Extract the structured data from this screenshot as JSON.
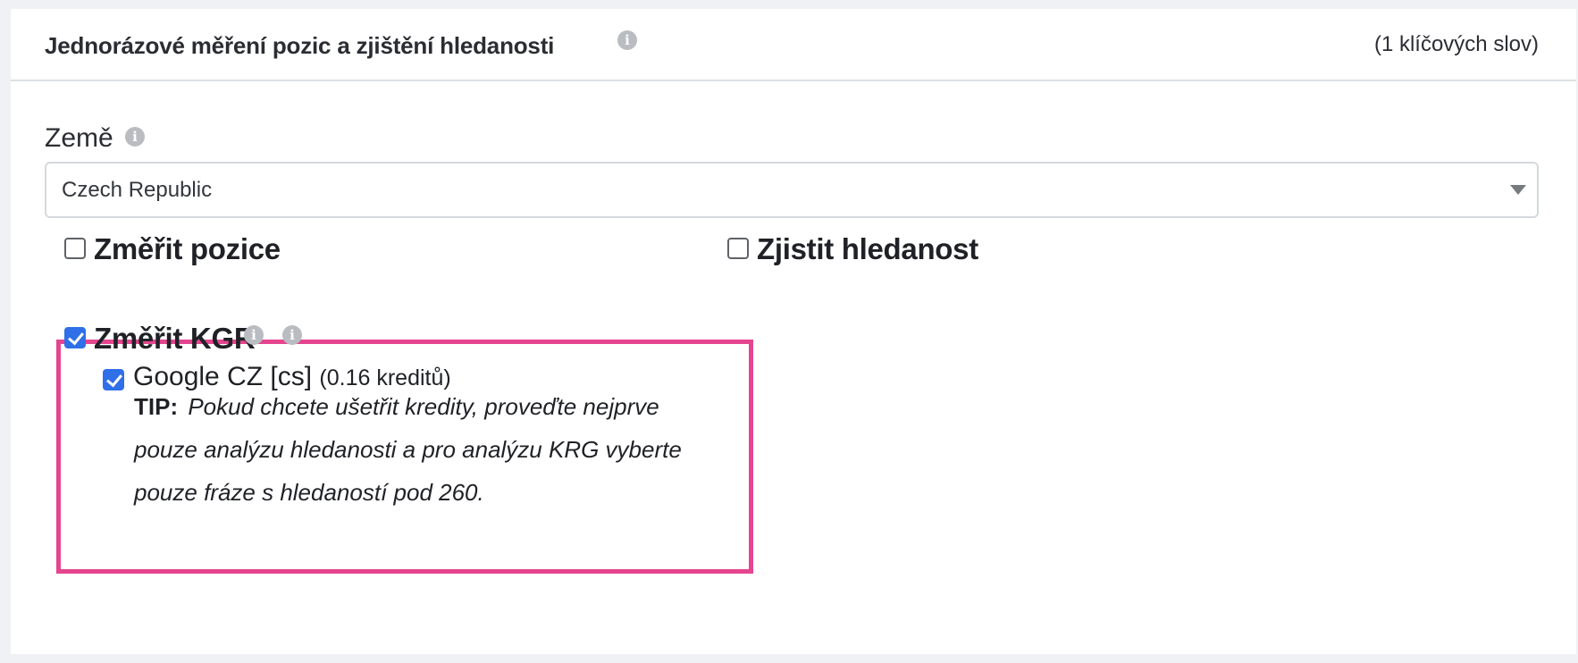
{
  "header": {
    "title": "Jednorázové měření pozic a zjištění hledanosti",
    "keyword_count": "(1 klíčových slov)"
  },
  "country": {
    "label": "Země",
    "selected": "Czech Republic"
  },
  "options": {
    "measure_positions": {
      "label": "Změřit pozice",
      "checked": false
    },
    "find_search_volume": {
      "label": "Zjistit hledanost",
      "checked": false
    },
    "measure_kgr": {
      "label": "Změřit KGR",
      "checked": true
    }
  },
  "kgr": {
    "engine_label": "Google CZ [cs]",
    "engine_credits": "(0.16 kreditů)",
    "engine_checked": true,
    "tip_label": "TIP:",
    "tip_text": "Pokud chcete ušetřit kredity, proveďte nejprve pouze analýzu hledanosti a pro analýzu KRG vyberte pouze fráze s hledaností pod 260."
  },
  "icons": {
    "info": "info-icon",
    "caret": "chevron-down-icon",
    "check": "checkmark-icon"
  },
  "colors": {
    "accent": "#2f6fe8",
    "highlight": "#e5458f"
  }
}
